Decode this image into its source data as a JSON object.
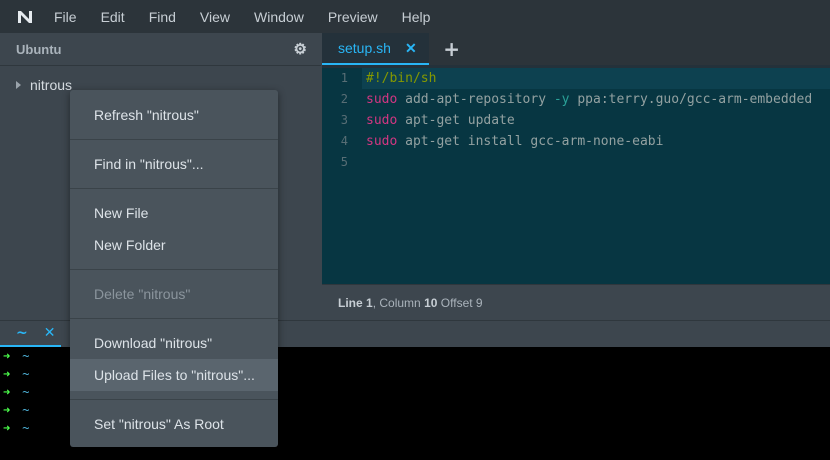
{
  "menubar": {
    "items": [
      "File",
      "Edit",
      "Find",
      "View",
      "Window",
      "Preview",
      "Help"
    ]
  },
  "sidebar": {
    "title": "Ubuntu",
    "tree_root": "nitrous"
  },
  "editor": {
    "tab": {
      "label": "setup.sh",
      "close": "✕"
    },
    "add_tab": "+",
    "line_numbers": [
      "1",
      "2",
      "3",
      "4",
      "5"
    ],
    "lines": [
      {
        "parts": [
          {
            "t": "#!/bin/sh",
            "k": "comment"
          }
        ]
      },
      {
        "parts": [
          {
            "t": "sudo",
            "k": "keyword"
          },
          {
            "t": " add-apt-repository ",
            "k": "plain"
          },
          {
            "t": "-y",
            "k": "flag"
          },
          {
            "t": " ppa:terry.guo/gcc-arm-embedded",
            "k": "plain"
          }
        ]
      },
      {
        "parts": [
          {
            "t": "sudo",
            "k": "keyword"
          },
          {
            "t": " apt-get update",
            "k": "plain"
          }
        ]
      },
      {
        "parts": [
          {
            "t": "sudo",
            "k": "keyword"
          },
          {
            "t": " apt-get install gcc-arm-none-eabi",
            "k": "plain"
          }
        ]
      },
      {
        "parts": []
      }
    ],
    "status": {
      "line_label": "Line",
      "line_value": "1",
      "col_label": "Column",
      "col_value": "10",
      "offset_label": "Offset",
      "offset_value": "9"
    }
  },
  "terminal": {
    "tab": {
      "label": "~",
      "close": "✕"
    },
    "lines": [
      {
        "arrow": "➜",
        "cwd": "~"
      },
      {
        "arrow": "➜",
        "cwd": "~"
      },
      {
        "arrow": "➜",
        "cwd": "~"
      },
      {
        "arrow": "➜",
        "cwd": "~"
      },
      {
        "arrow": "➜",
        "cwd": "~"
      }
    ]
  },
  "context_menu": {
    "refresh": "Refresh \"nitrous\"",
    "find_in": "Find in \"nitrous\"...",
    "new_file": "New File",
    "new_folder": "New Folder",
    "delete": "Delete \"nitrous\"",
    "download": "Download \"nitrous\"",
    "upload": "Upload Files to \"nitrous\"...",
    "set_root": "Set \"nitrous\" As Root"
  },
  "colors": {
    "accent": "#29b6f6",
    "editor_bg": "#073642",
    "terminal_bg": "#000000",
    "prompt_arrow": "#4cff4c"
  }
}
